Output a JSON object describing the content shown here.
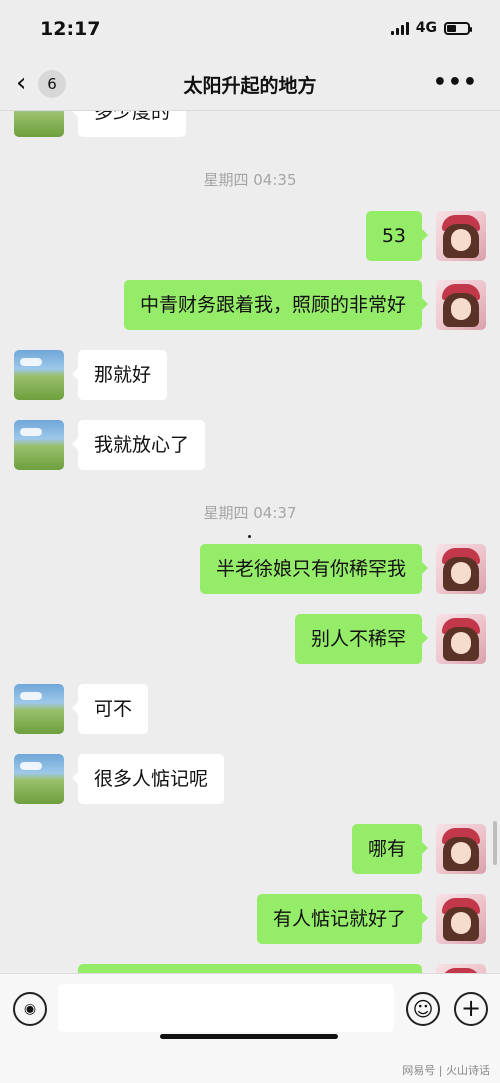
{
  "status": {
    "time": "12:17",
    "network": "4G"
  },
  "nav": {
    "back_glyph": "‹",
    "unread_count": "6",
    "title": "太阳升起的地方",
    "more_glyph": "•••"
  },
  "messages": [
    {
      "side": "in",
      "text": "多少度的"
    },
    {
      "type": "timestamp",
      "text": "星期四 04:35"
    },
    {
      "side": "out",
      "text": "53"
    },
    {
      "side": "out",
      "text": "中青财务跟着我，照顾的非常好"
    },
    {
      "side": "in",
      "text": "那就好"
    },
    {
      "side": "in",
      "text": "我就放心了"
    },
    {
      "type": "timestamp",
      "text": "星期四 04:37"
    },
    {
      "side": "out",
      "text": "半老徐娘只有你稀罕我"
    },
    {
      "side": "out",
      "text": "别人不稀罕"
    },
    {
      "side": "in",
      "text": "可不"
    },
    {
      "side": "in",
      "text": "很多人惦记呢"
    },
    {
      "side": "out",
      "text": "哪有"
    },
    {
      "side": "out",
      "text": "有人惦记就好了"
    },
    {
      "side": "out",
      "text": ""
    }
  ],
  "input": {
    "placeholder": "",
    "voice_icon": "voice-icon",
    "emoji_icon": "emoji-icon",
    "plus_icon": "plus-icon",
    "voice_glyph": "◉",
    "emoji_glyph": "☺",
    "plus_glyph": "+"
  },
  "watermark": "网易号 | 火山诗话",
  "colors": {
    "background": "#ededed",
    "outgoing_bubble": "#95ec69",
    "incoming_bubble": "#ffffff",
    "timestamp": "#a5a5a5"
  }
}
